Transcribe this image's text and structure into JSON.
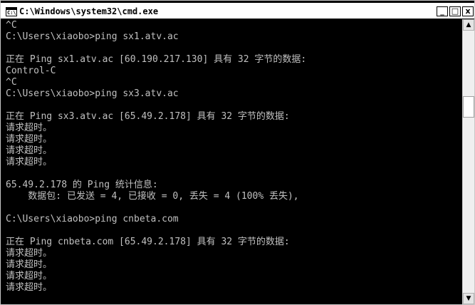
{
  "window": {
    "title": "C:\\Windows\\system32\\cmd.exe",
    "icon_label": "C:\\",
    "buttons": {
      "minimize": "_",
      "maximize": "□",
      "close": "x"
    }
  },
  "console": {
    "lines": [
      "^C",
      "C:\\Users\\xiaobo>ping sx1.atv.ac",
      "",
      "正在 Ping sx1.atv.ac [60.190.217.130] 具有 32 字节的数据:",
      "Control-C",
      "^C",
      "C:\\Users\\xiaobo>ping sx3.atv.ac",
      "",
      "正在 Ping sx3.atv.ac [65.49.2.178] 具有 32 字节的数据:",
      "请求超时。",
      "请求超时。",
      "请求超时。",
      "请求超时。",
      "",
      "65.49.2.178 的 Ping 统计信息:",
      "    数据包: 已发送 = 4, 已接收 = 0, 丢失 = 4 (100% 丢失),",
      "",
      "C:\\Users\\xiaobo>ping cnbeta.com",
      "",
      "正在 Ping cnbeta.com [65.49.2.178] 具有 32 字节的数据:",
      "请求超时。",
      "请求超时。",
      "请求超时。",
      "请求超时。"
    ]
  },
  "scrollbar": {
    "up_arrow": "▲",
    "down_arrow": "▼"
  }
}
